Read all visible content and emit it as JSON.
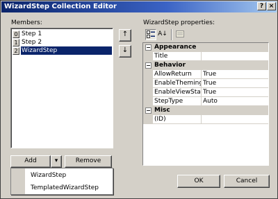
{
  "window": {
    "title": "WizardStep Collection Editor",
    "help_glyph": "?",
    "close_glyph": "×"
  },
  "members": {
    "label": "Members:",
    "items": [
      {
        "index": "0",
        "label": "Step 1",
        "selected": false
      },
      {
        "index": "1",
        "label": "Step 2",
        "selected": false
      },
      {
        "index": "2",
        "label": "WizardStep",
        "selected": true
      }
    ],
    "move_up_glyph": "↑",
    "move_down_glyph": "↓"
  },
  "properties": {
    "label": "WizardStep properties:",
    "toolbar": {
      "categorized_icon": "categorized-icon",
      "alphabetical_glyph": "A↓",
      "property_pages_icon": "property-pages-icon"
    },
    "categories": [
      {
        "name": "Appearance",
        "expander": "−",
        "props": [
          {
            "name": "Title",
            "value": ""
          }
        ]
      },
      {
        "name": "Behavior",
        "expander": "−",
        "props": [
          {
            "name": "AllowReturn",
            "value": "True"
          },
          {
            "name": "EnableTheming",
            "value": "True"
          },
          {
            "name": "EnableViewState",
            "value": "True"
          },
          {
            "name": "StepType",
            "value": "Auto"
          }
        ]
      },
      {
        "name": "Misc",
        "expander": "−",
        "props": [
          {
            "name": "(ID)",
            "value": ""
          }
        ]
      }
    ]
  },
  "buttons": {
    "add": "Add",
    "add_arrow": "▾",
    "remove": "Remove",
    "ok": "OK",
    "cancel": "Cancel"
  },
  "add_menu": {
    "items": [
      "WizardStep",
      "TemplatedWizardStep"
    ]
  }
}
